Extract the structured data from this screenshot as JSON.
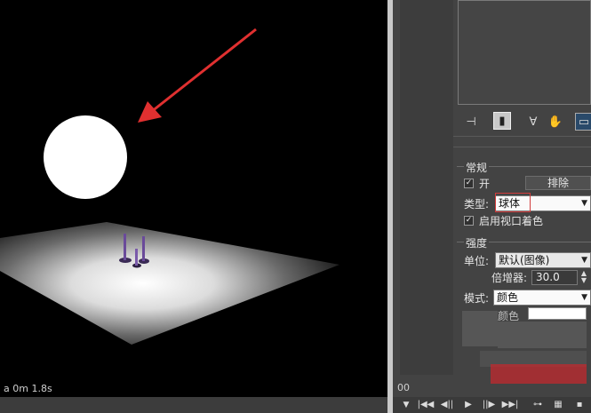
{
  "viewport": {
    "status_time": "a 0m 1.8s"
  },
  "panel": {
    "toolbar_icons": [
      "pin-icon",
      "modifier-stack-icon",
      "funnel-icon",
      "hand-icon",
      "display-icon"
    ],
    "general_group": {
      "title": "常规",
      "on_label": "开",
      "on_checked": true,
      "exclude_label": "排除",
      "type_label": "类型:",
      "type_value": "球体",
      "viewport_shading_label": "启用视口着色",
      "viewport_shading_checked": true
    },
    "intensity_group": {
      "title": "强度",
      "unit_label": "单位:",
      "unit_value": "默认(图像)",
      "multiplier_label": "倍增器:",
      "multiplier_value": "30.0",
      "mode_label": "模式:",
      "mode_value": "颜色",
      "color_label": "颜色"
    },
    "ruler_label": "00"
  },
  "colors": {
    "viewport_bg": "#000000",
    "panel_bg": "#434343",
    "annotation_red": "#e03030",
    "highlight_box": "#d23c3c"
  }
}
